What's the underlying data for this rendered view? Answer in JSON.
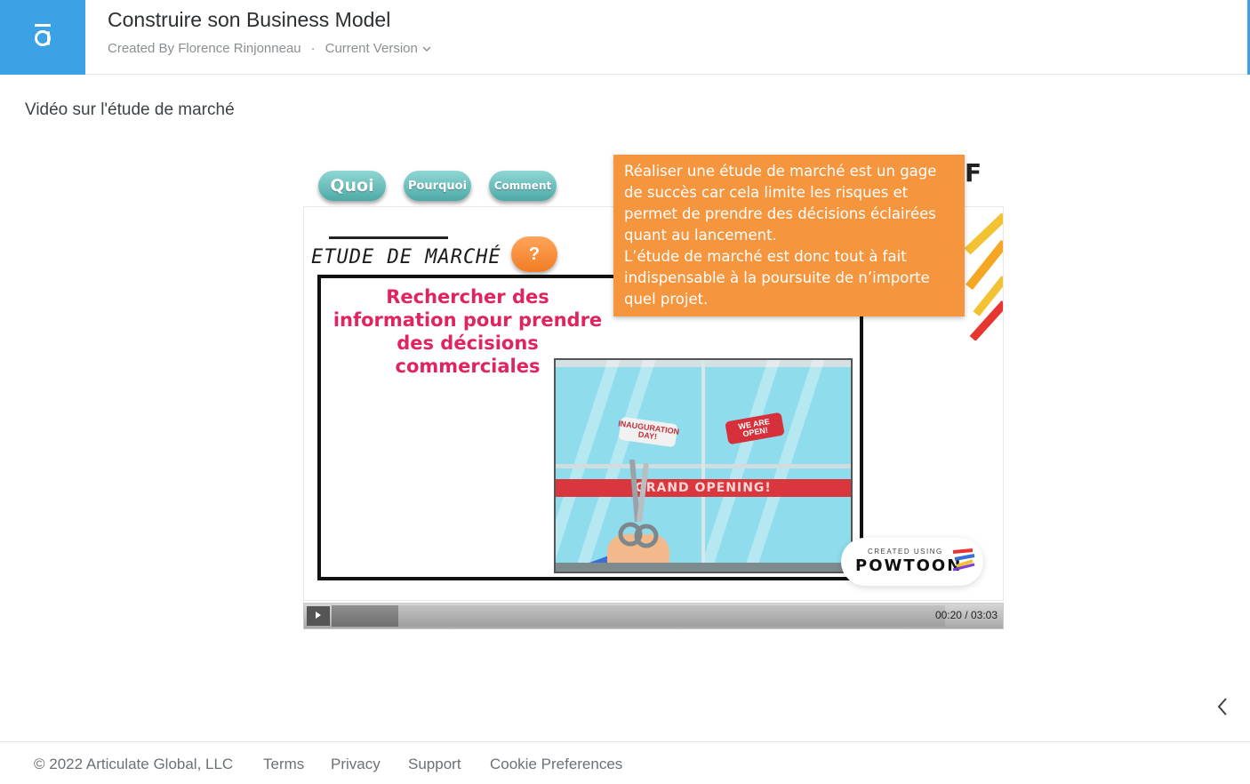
{
  "header": {
    "logo_glyph": "ā",
    "course_title": "Construire son Business Model",
    "author": "Created By Florence Rinjonneau",
    "separator": "·",
    "version_label": "Current Version",
    "accent_color": "#3ba2e6"
  },
  "lesson": {
    "title": "Vidéo sur l'étude de marché"
  },
  "video": {
    "tabs": [
      "Quoi",
      "Pourquoi",
      "Comment"
    ],
    "corner_letter": "F",
    "slide_title": "ETUDE DE MARCHÉ",
    "question_label": "?",
    "board_text": "Rechercher des information pour prendre des décisions commerciales",
    "sign_left": "INAUGURATION DAY!",
    "sign_right": "WE ARE OPEN!",
    "ribbon_text": "GRAND OPENING!",
    "watermark_small": "CREATED USING",
    "watermark_big": "POWTOON",
    "tooltip_para1": "Réaliser une étude de marché est un gage de succès car cela limite les risques et permet de prendre des décisions éclairées quant au lancement.",
    "tooltip_para2": "L’étude de marché est donc tout à fait indispensable à la poursuite de n’importe quel projet.",
    "tooltip_color": "#f5963f",
    "time_display": "00:20 / 03:03",
    "progress_fraction": 0.109
  },
  "footer": {
    "copyright": "© 2022 Articulate Global, LLC",
    "links": [
      "Terms",
      "Privacy",
      "Support",
      "Cookie Preferences"
    ]
  }
}
